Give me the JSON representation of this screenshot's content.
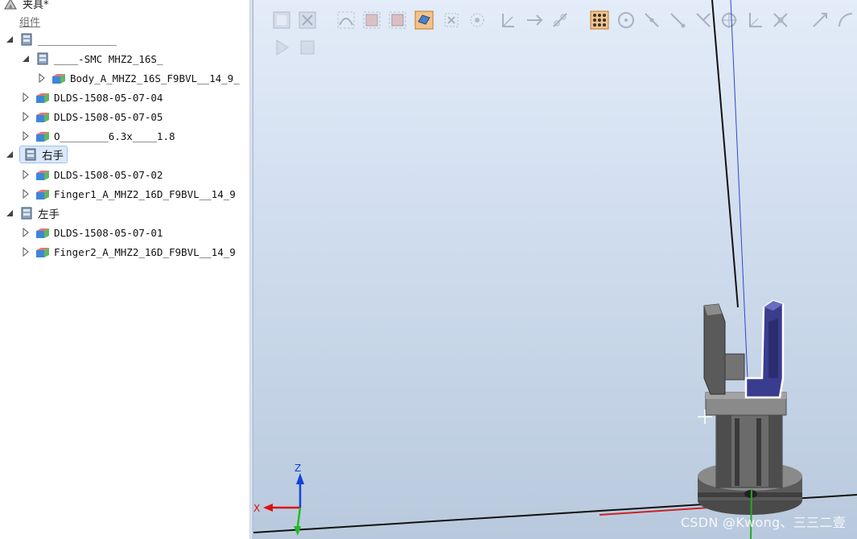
{
  "tree": {
    "root_label": "夹具*",
    "sub_label": "组件",
    "nodes": [
      {
        "label": "_____________",
        "font": "mono"
      },
      {
        "label": "____-SMC MHZ2_16S_",
        "font": "mono"
      },
      {
        "label": "Body_A_MHZ2_16S_F9BVL__14_9_",
        "font": "mono"
      },
      {
        "label": "DLDS-1508-05-07-04",
        "font": "mono"
      },
      {
        "label": "DLDS-1508-05-07-05",
        "font": "mono"
      },
      {
        "label": "O________6.3x____1.8",
        "font": "mono"
      },
      {
        "label": "右手",
        "font": "cjk"
      },
      {
        "label": "DLDS-1508-05-07-02",
        "font": "mono"
      },
      {
        "label": "Finger1_A_MHZ2_16D_F9BVL__14_9",
        "font": "mono"
      },
      {
        "label": "左手",
        "font": "cjk"
      },
      {
        "label": "DLDS-1508-05-07-01",
        "font": "mono"
      },
      {
        "label": "Finger2_A_MHZ2_16D_F9BVL__14_9",
        "font": "mono"
      }
    ]
  },
  "toolbar": {
    "icons": [
      "view-all-icon",
      "view-center-icon",
      "select-curve-icon",
      "select-surface-icon",
      "select-body-icon",
      "select-part-icon",
      "select-mechanism-icon",
      "select-group-icon",
      "snap-object-icon",
      "snap-edge-icon",
      "snap-grid-icon",
      "snap-center-icon",
      "snap-midpoint-icon",
      "snap-end-icon",
      "snap-edge-point-icon",
      "snap-gravity-icon",
      "snap-local-origin-icon",
      "snap-grid-point-icon",
      "measure-distance-icon",
      "measure-angle-icon",
      "play-icon",
      "stop-icon"
    ]
  },
  "axes": {
    "x_label": "X",
    "z_label": "Z"
  },
  "watermark": "CSDN @Kwong、三三二壹"
}
